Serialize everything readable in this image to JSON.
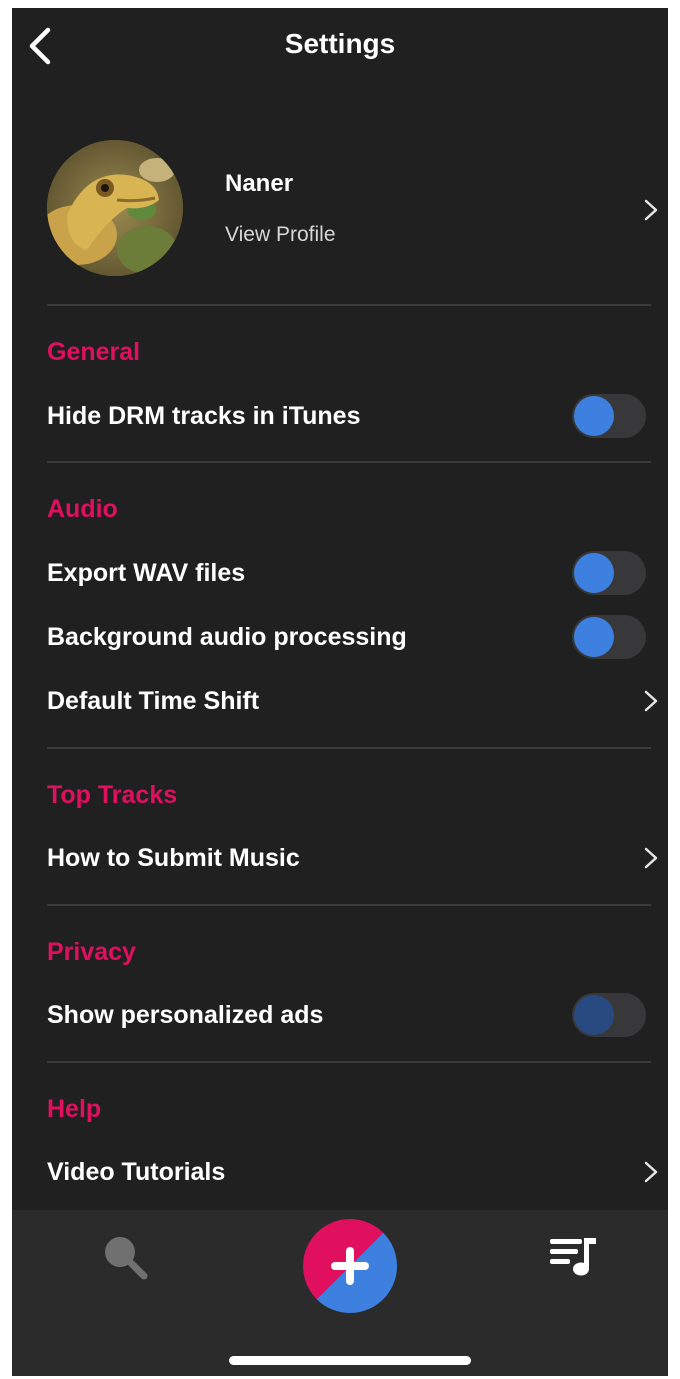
{
  "header": {
    "title": "Settings",
    "back_icon": "chevron-left-icon"
  },
  "profile": {
    "name": "Naner",
    "subtitle": "View Profile",
    "avatar_icon": "frog-avatar"
  },
  "colors": {
    "background": "#202020",
    "section_accent": "#e0105f",
    "toggle_knob": "#3e80e0",
    "toggle_track": "#38383b",
    "divider": "#3a3a3a",
    "tabbar": "#2b2b2b"
  },
  "sections": {
    "general": {
      "title": "General",
      "items": [
        {
          "label": "Hide DRM tracks in iTunes",
          "control": "toggle"
        }
      ]
    },
    "audio": {
      "title": "Audio",
      "items": [
        {
          "label": "Export WAV files",
          "control": "toggle"
        },
        {
          "label": "Background audio processing",
          "control": "toggle"
        },
        {
          "label": "Default Time Shift",
          "control": "chevron"
        }
      ]
    },
    "top_tracks": {
      "title": "Top Tracks",
      "items": [
        {
          "label": "How to Submit Music",
          "control": "chevron"
        }
      ]
    },
    "privacy": {
      "title": "Privacy",
      "items": [
        {
          "label": "Show personalized ads",
          "control": "toggle",
          "disabled": true
        }
      ]
    },
    "help": {
      "title": "Help",
      "items": [
        {
          "label": "Video Tutorials",
          "control": "chevron"
        }
      ]
    }
  },
  "tabbar": {
    "items": [
      {
        "icon": "search-icon"
      },
      {
        "icon": "plus-icon"
      },
      {
        "icon": "music-queue-icon"
      }
    ]
  }
}
